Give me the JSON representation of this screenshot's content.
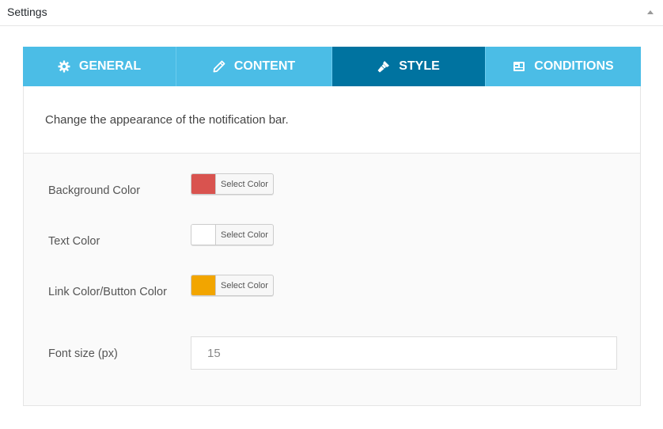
{
  "panel": {
    "title": "Settings"
  },
  "tabs": [
    {
      "label": "GENERAL",
      "icon": "gear-icon",
      "active": false
    },
    {
      "label": "CONTENT",
      "icon": "pencil-icon",
      "active": false
    },
    {
      "label": "STYLE",
      "icon": "brush-icon",
      "active": true
    },
    {
      "label": "CONDITIONS",
      "icon": "layout-icon",
      "active": false
    }
  ],
  "intro": {
    "text": "Change the appearance of the notification bar."
  },
  "fields": {
    "background_color": {
      "label": "Background Color",
      "button_label": "Select Color",
      "color": "#d9534f"
    },
    "text_color": {
      "label": "Text Color",
      "button_label": "Select Color",
      "color": "#ffffff"
    },
    "link_color": {
      "label": "Link Color/Button Color",
      "button_label": "Select Color",
      "color": "#f2a500"
    },
    "font_size": {
      "label": "Font size (px)",
      "value": "15"
    }
  },
  "colors": {
    "tab_bg": "#4bbde6",
    "tab_active_bg": "#0073a0"
  }
}
